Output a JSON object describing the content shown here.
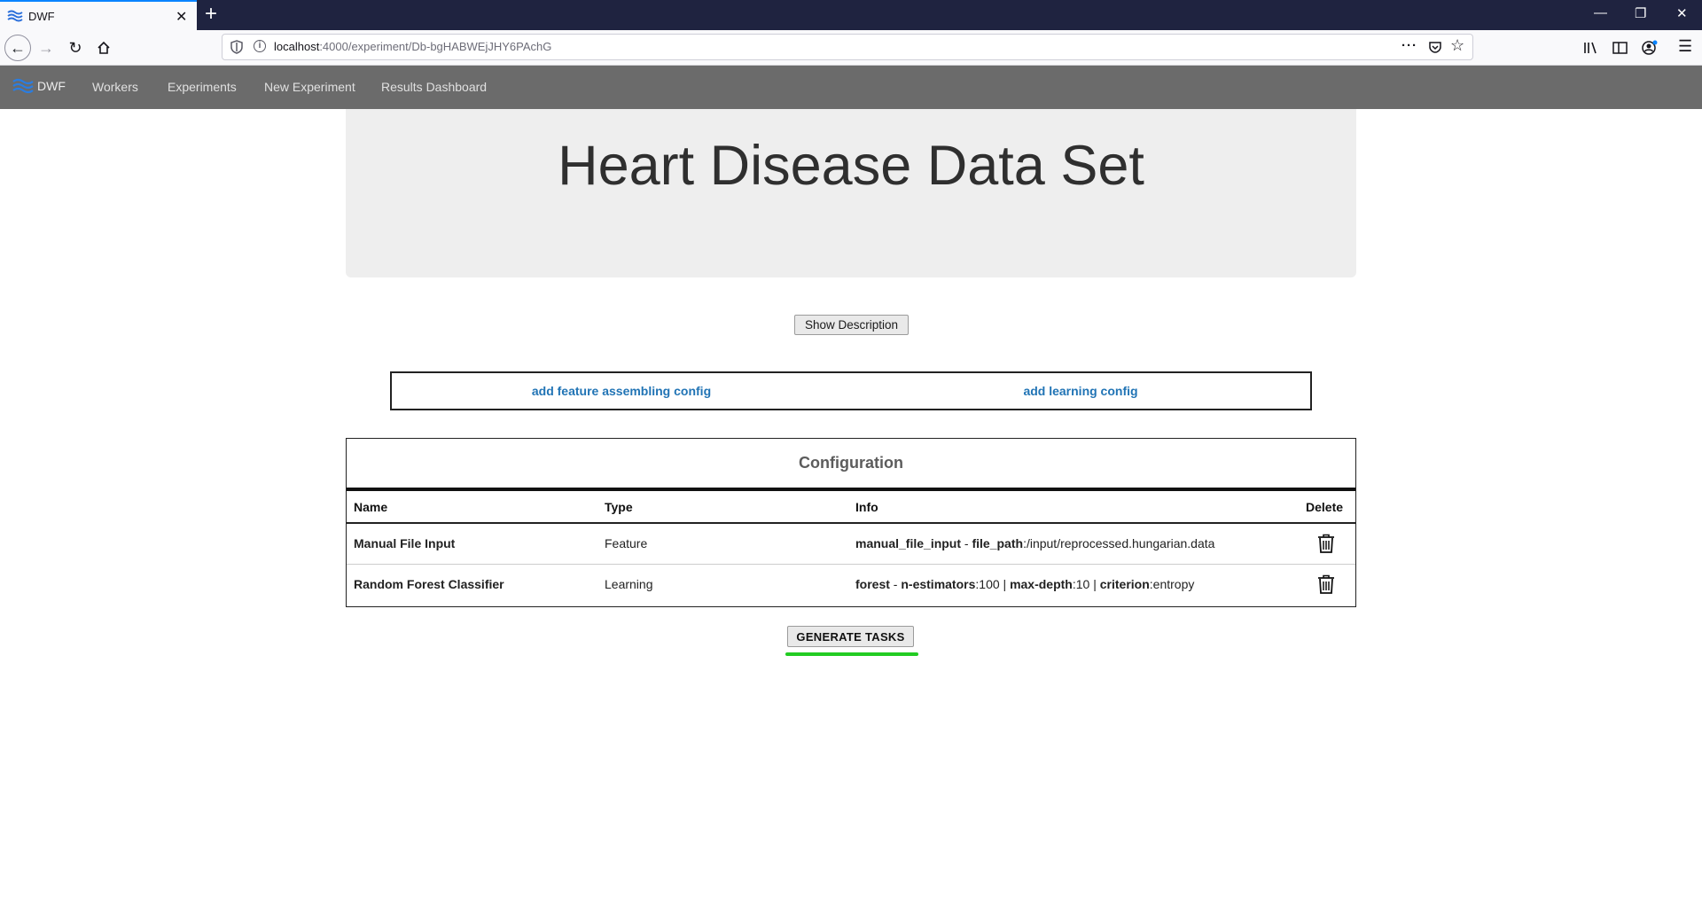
{
  "browser": {
    "tab_title": "DWF",
    "url_host": "localhost",
    "url_path": ":4000/experiment/Db-bgHABWEjJHY6PAchG",
    "new_tab_symbol": "+",
    "close_symbol": "✕"
  },
  "app_nav": {
    "brand": "DWF",
    "links": [
      "Workers",
      "Experiments",
      "New Experiment",
      "Results Dashboard"
    ]
  },
  "jumbotron": {
    "title": "Heart Disease Data Set"
  },
  "show_description_label": "Show Description",
  "add_config": {
    "feature_label": "add feature assembling config",
    "learning_label": "add learning config"
  },
  "configuration": {
    "title": "Configuration",
    "columns": [
      "Name",
      "Type",
      "Info",
      "Delete"
    ],
    "rows": [
      {
        "name": "Manual File Input",
        "type": "Feature",
        "info": [
          {
            "b": "manual_file_input"
          },
          {
            "t": " - "
          },
          {
            "b": "file_path"
          },
          {
            "t": ":/input/reprocessed.hungarian.data"
          }
        ]
      },
      {
        "name": "Random Forest Classifier",
        "type": "Learning",
        "info": [
          {
            "b": "forest"
          },
          {
            "t": " - "
          },
          {
            "b": "n-estimators"
          },
          {
            "t": ":100 | "
          },
          {
            "b": "max-depth"
          },
          {
            "t": ":10 | "
          },
          {
            "b": "criterion"
          },
          {
            "t": ":entropy"
          }
        ]
      }
    ]
  },
  "generate_tasks_label": "GENERATE TASKS",
  "colors": {
    "nav_bg": "#6b6b6b",
    "link_blue": "#2174b5",
    "accent_green": "#22cc22",
    "tabbar_bg": "#1f2340"
  }
}
